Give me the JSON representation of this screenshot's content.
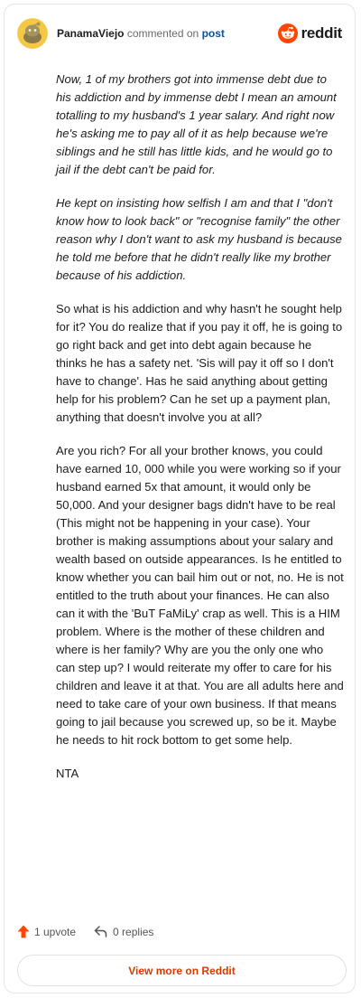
{
  "header": {
    "username": "PanamaViejo",
    "action": "commented on",
    "post_link": "post",
    "brand": "reddit"
  },
  "comment": {
    "paragraphs": [
      {
        "style": "italic",
        "text": "Now, 1 of my brothers got into immense debt due to his addiction and by immense debt I mean an amount totalling to my husband's 1 year salary. And right now he's asking me to pay all of it as help because we're siblings and he still has little kids, and he would go to jail if the debt can't be paid for."
      },
      {
        "style": "italic",
        "text": "He kept on insisting how selfish I am and that I \"don't know how to look back\" or \"recognise family\" the other reason why I don't want to ask my husband is because he told me before that he didn't really like my brother because of his addiction."
      },
      {
        "style": "normal",
        "text": "So what is his addiction and why hasn't he sought help for it? You do realize that if you pay it off, he is going to go right back and get into debt again because he thinks he has a safety net. 'Sis will pay it off so I don't have to change'. Has he said anything about getting help for his problem? Can he set up a payment plan, anything that doesn't involve you at all?"
      },
      {
        "style": "normal",
        "text": "Are you rich? For all your brother knows, you could have earned 10, 000 while you were working so if your husband earned 5x that amount, it would only be 50,000. And your designer bags didn't have to be real (This might not be happening in your case). Your brother is making assumptions about your salary and wealth based on outside appearances. Is he entitled to know whether you can bail him out or not, no. He is not entitled to the truth about your finances. He can also can it with the 'BuT FaMiLy' crap as well. This is a HIM problem. Where is the mother of these children and where is her family? Why are you the only one who can step up? I would reiterate my offer to care for his children and leave it at that. You are all adults here and need to take care of your own business. If that means going to jail because you screwed up, so be it. Maybe he needs to hit rock bottom to get some help."
      },
      {
        "style": "normal",
        "text": "NTA"
      }
    ]
  },
  "footer": {
    "upvotes": "1 upvote",
    "replies": "0 replies",
    "view_more": "View more on Reddit"
  },
  "colors": {
    "accent": "#ff4500",
    "link": "#0a4fa6",
    "view_more": "#d93a00",
    "avatar_bg": "#f5c843"
  },
  "icons": {
    "avatar": "snoo-avatar",
    "brand": "reddit-logo-icon",
    "upvote": "upvote-arrow-icon",
    "reply": "reply-arrow-icon"
  }
}
